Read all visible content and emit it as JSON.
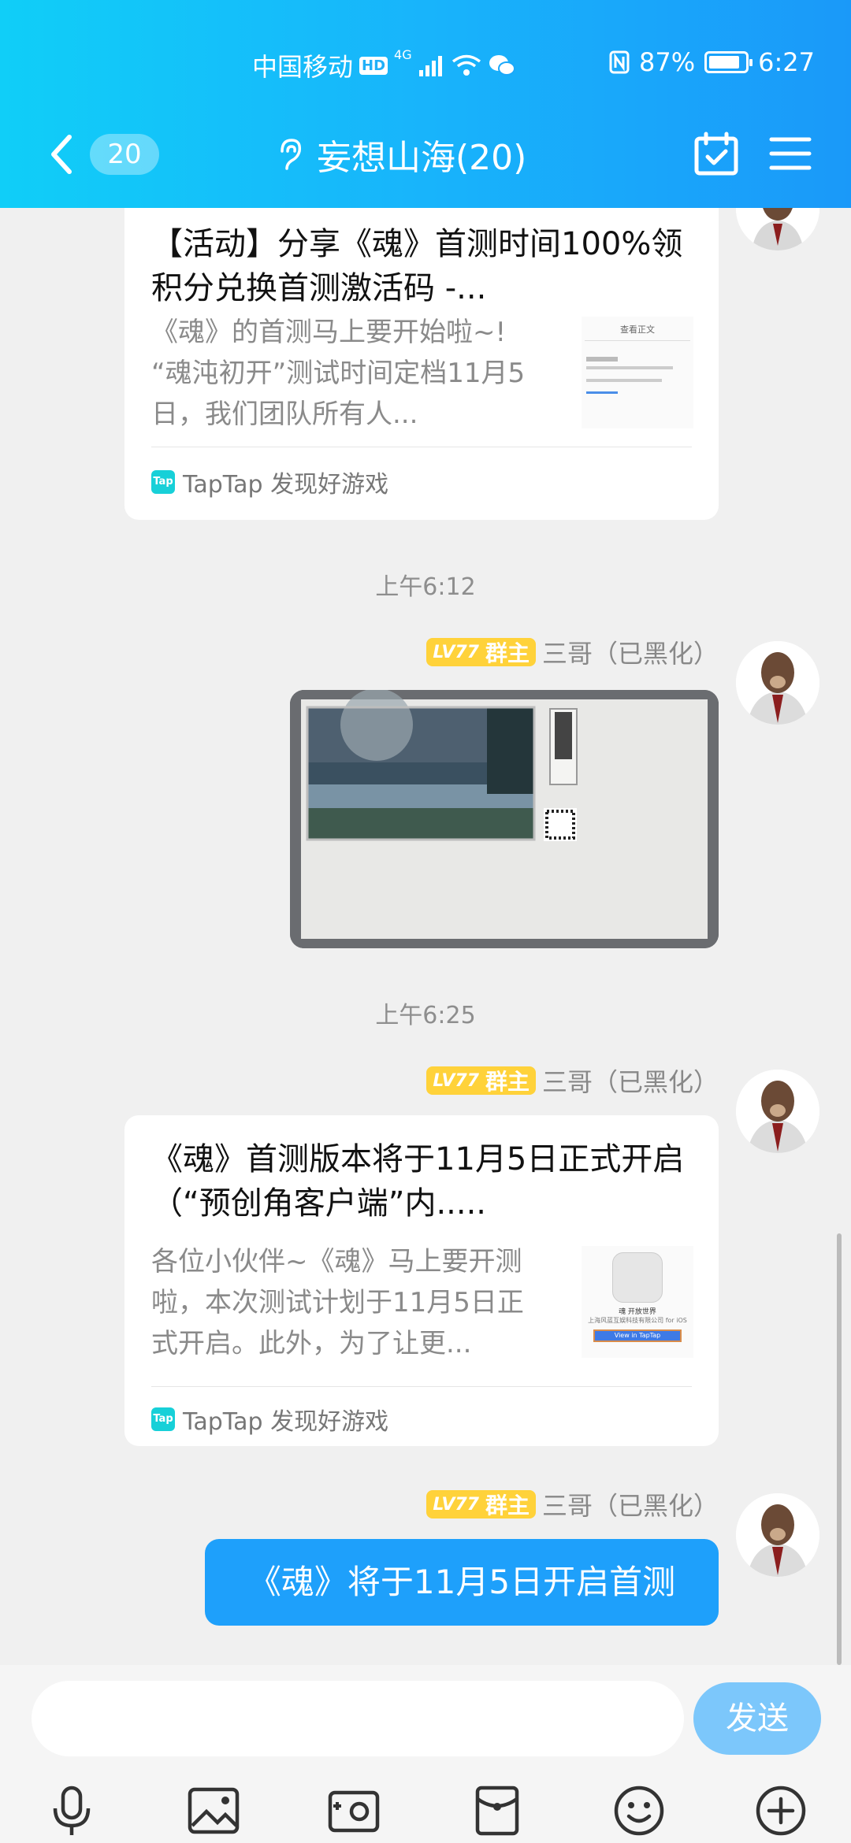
{
  "status_bar": {
    "carrier": "中国移动",
    "hd": "HD",
    "network": "4G",
    "battery": "87%",
    "battery_level": 0.87,
    "time": "6:27"
  },
  "header": {
    "unread_count": "20",
    "title": "妄想山海(20)"
  },
  "messages": {
    "card1": {
      "title": "【活动】分享《魂》首测时间100%领积分兑换首测激活码 -...",
      "desc": "《魂》的首测马上要开始啦~! “魂沌初开”测试时间定档11月5日，我们团队所有人...",
      "source": "TapTap 发现好游戏",
      "thumb_heading": "查看正文"
    },
    "time1": "上午6:12",
    "sender1": {
      "level": "LV77",
      "role": "群主",
      "name": "三哥（已黑化）"
    },
    "time2": "上午6:25",
    "sender2": {
      "level": "LV77",
      "role": "群主",
      "name": "三哥（已黑化）"
    },
    "card2": {
      "title": "《魂》首测版本将于11月5日正式开启（“预创角客户端”内.....",
      "desc": "各位小伙伴~《魂》马上要开测啦，本次测试计划于11月5日正式开启。此外，为了让更...",
      "source": "TapTap 发现好游戏",
      "thumb_caption": "魂 开放世界",
      "thumb_sub": "上海风蓝互娱科技有限公司 for iOS",
      "thumb_btn": "View in TapTap"
    },
    "sender3": {
      "level": "LV77",
      "role": "群主",
      "name": "三哥（已黑化）"
    },
    "text3": "《魂》将于11月5日开启首测"
  },
  "input": {
    "placeholder": "",
    "send_label": "发送"
  },
  "toolbar": [
    "microphone-icon",
    "image-icon",
    "camera-icon",
    "red-packet-icon",
    "emoji-icon",
    "plus-icon"
  ]
}
